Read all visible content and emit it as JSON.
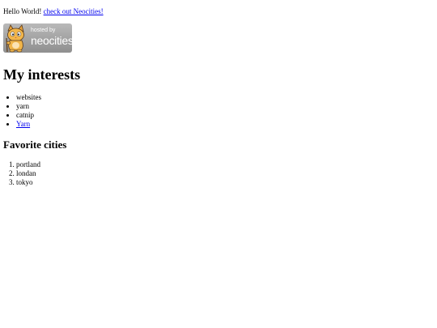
{
  "intro": {
    "text": "Hello World!",
    "link_label": "check out Neocities!"
  },
  "badge": {
    "hosted_by": "hosted by",
    "brand": "neocities",
    "mascot_icon": "cat-mascot-icon",
    "colors": {
      "background": "#a6a6a6",
      "text": "#ffffff"
    }
  },
  "interests": {
    "heading": "My interests",
    "items": [
      {
        "label": "websites",
        "is_link": false
      },
      {
        "label": "yarn",
        "is_link": false
      },
      {
        "label": "catnip",
        "is_link": false
      },
      {
        "label": "Yarn",
        "is_link": true
      }
    ]
  },
  "cities": {
    "heading": "Favorite cities",
    "items": [
      "portland",
      "londan",
      "tokyo"
    ]
  },
  "colors": {
    "link": "#0000ee",
    "text": "#000000",
    "background": "#ffffff"
  }
}
